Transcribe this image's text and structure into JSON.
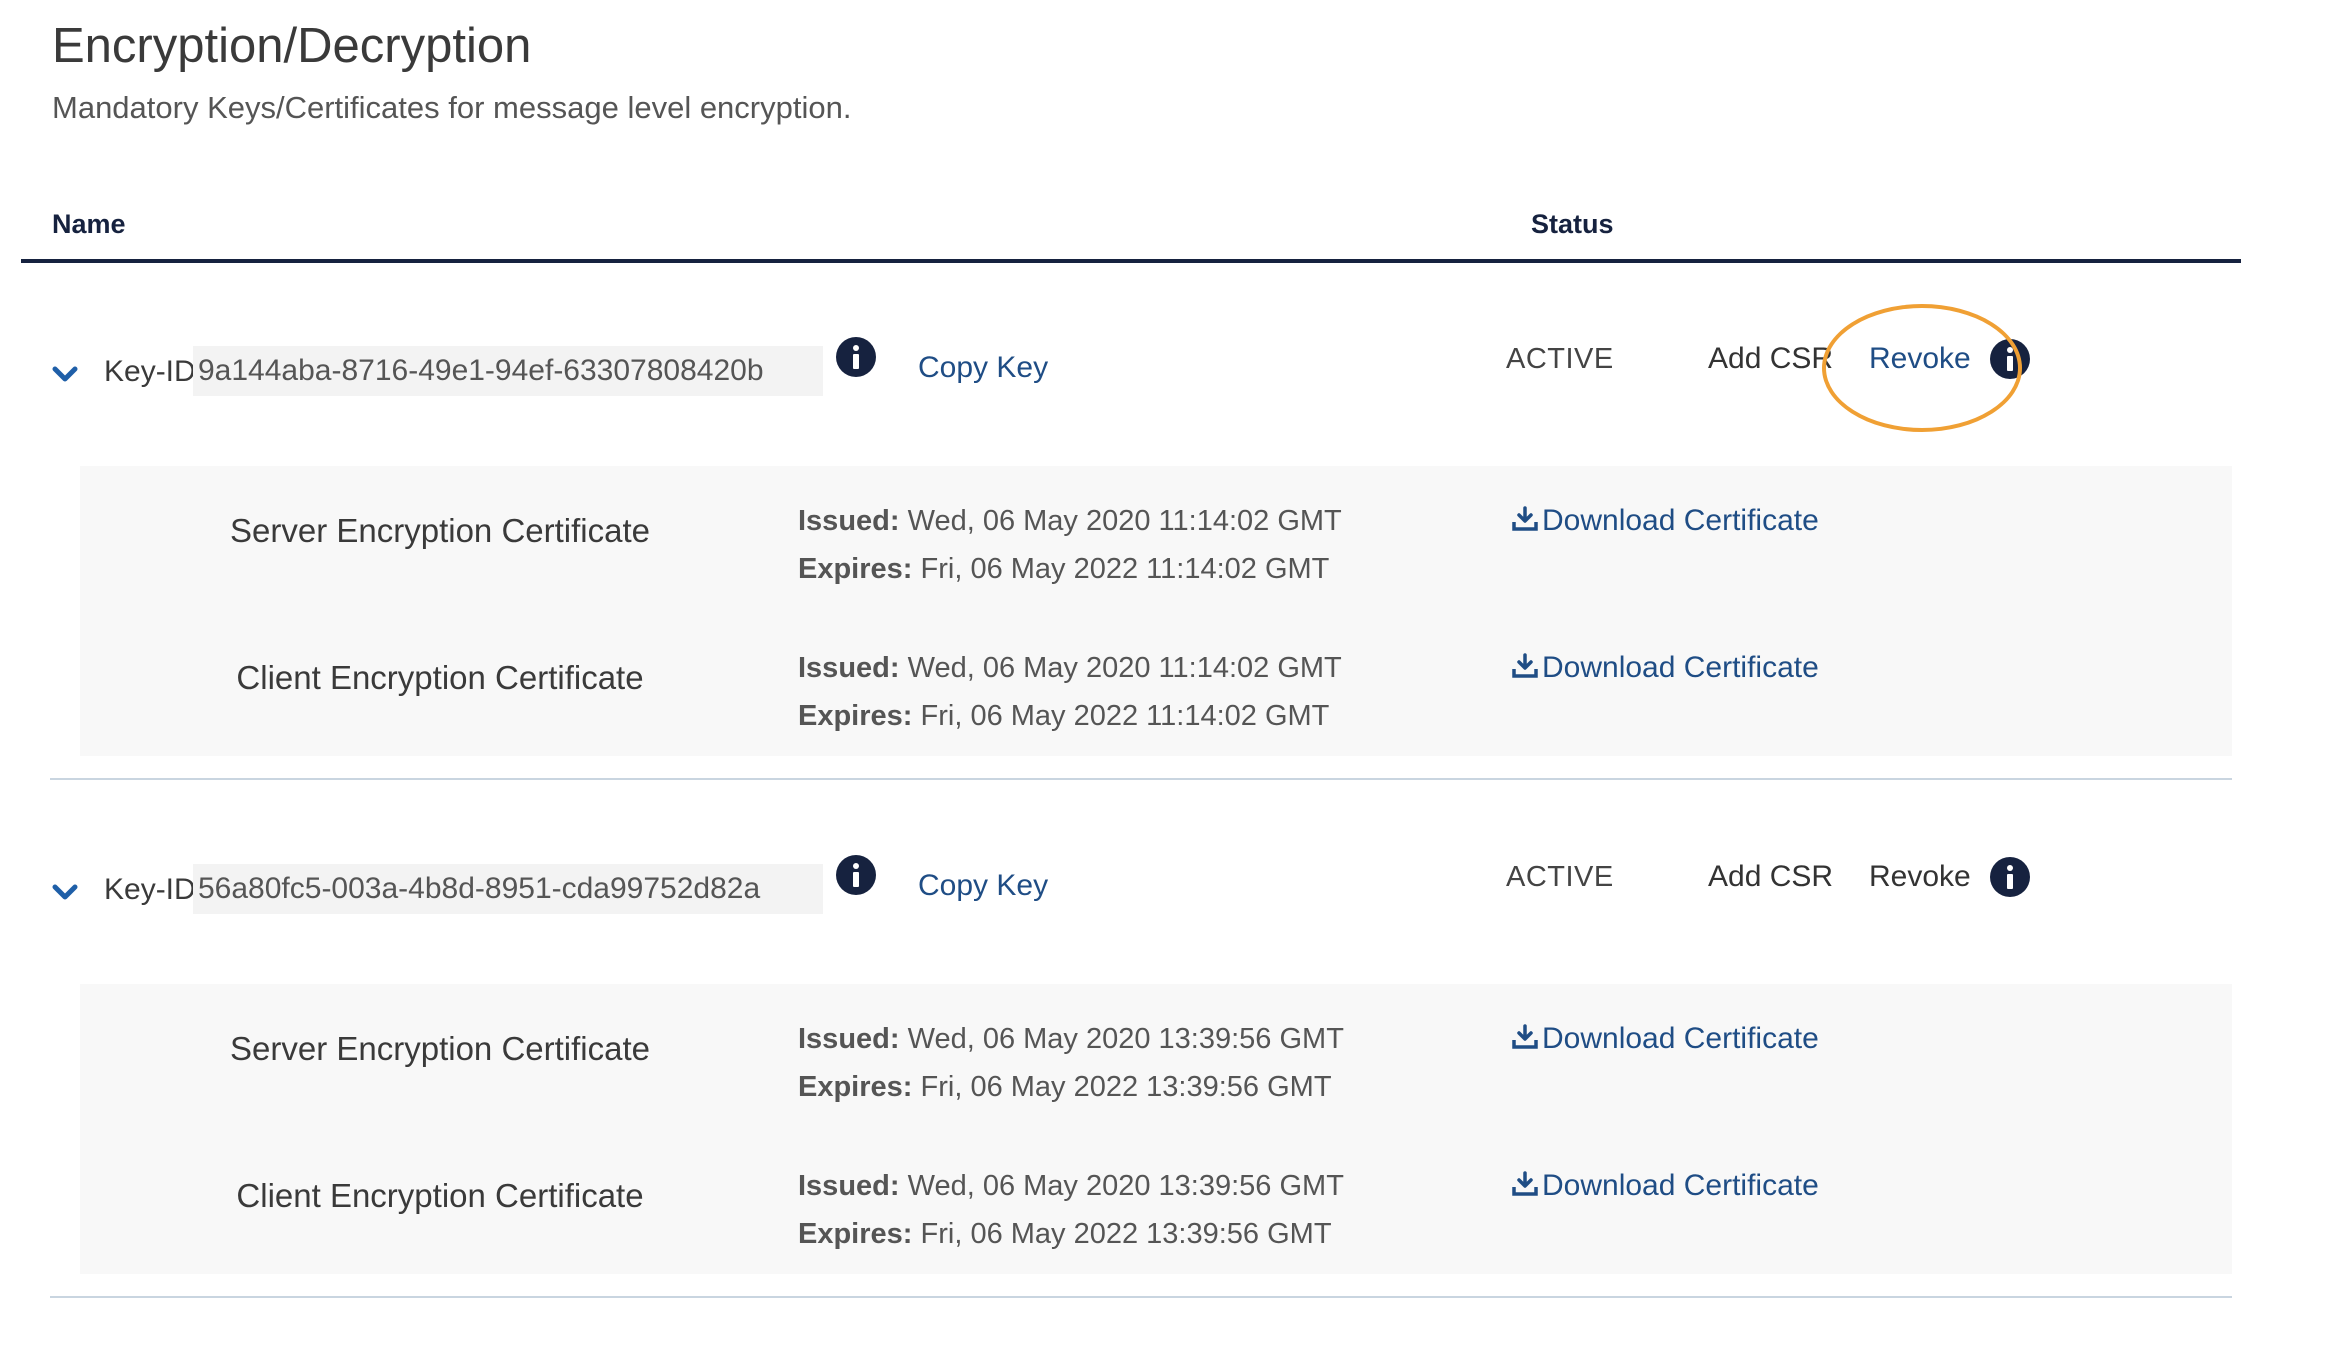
{
  "page": {
    "title": "Encryption/Decryption",
    "subtitle": "Mandatory Keys/Certificates for message level encryption."
  },
  "table": {
    "headers": {
      "name": "Name",
      "status": "Status"
    }
  },
  "colors": {
    "navy": "#16223f",
    "link": "#1f4d85",
    "highlight": "#f0a034",
    "panel_bg": "#f8f8f8"
  },
  "keys": [
    {
      "key_id_label": "Key-ID:",
      "key_id": "9a144aba-8716-49e1-94ef-63307808420b",
      "copy_label": "Copy Key",
      "status": "ACTIVE",
      "add_csr_label": "Add CSR",
      "revoke_label": "Revoke",
      "certificates": [
        {
          "name": "Server Encryption Certificate",
          "issued_label": "Issued:",
          "issued": "Wed, 06 May 2020 11:14:02 GMT",
          "expires_label": "Expires:",
          "expires": "Fri, 06 May 2022 11:14:02 GMT",
          "download_label": "Download Certificate"
        },
        {
          "name": "Client Encryption Certificate",
          "issued_label": "Issued:",
          "issued": "Wed, 06 May 2020 11:14:02 GMT",
          "expires_label": "Expires:",
          "expires": "Fri, 06 May 2022 11:14:02 GMT",
          "download_label": "Download Certificate"
        }
      ]
    },
    {
      "key_id_label": "Key-ID:",
      "key_id": "56a80fc5-003a-4b8d-8951-cda99752d82a",
      "copy_label": "Copy Key",
      "status": "ACTIVE",
      "add_csr_label": "Add CSR",
      "revoke_label": "Revoke",
      "certificates": [
        {
          "name": "Server Encryption Certificate",
          "issued_label": "Issued:",
          "issued": "Wed, 06 May 2020 13:39:56 GMT",
          "expires_label": "Expires:",
          "expires": "Fri, 06 May 2022 13:39:56 GMT",
          "download_label": "Download Certificate"
        },
        {
          "name": "Client Encryption Certificate",
          "issued_label": "Issued:",
          "issued": "Wed, 06 May 2020 13:39:56 GMT",
          "expires_label": "Expires:",
          "expires": "Fri, 06 May 2022 13:39:56 GMT",
          "download_label": "Download Certificate"
        }
      ]
    }
  ]
}
